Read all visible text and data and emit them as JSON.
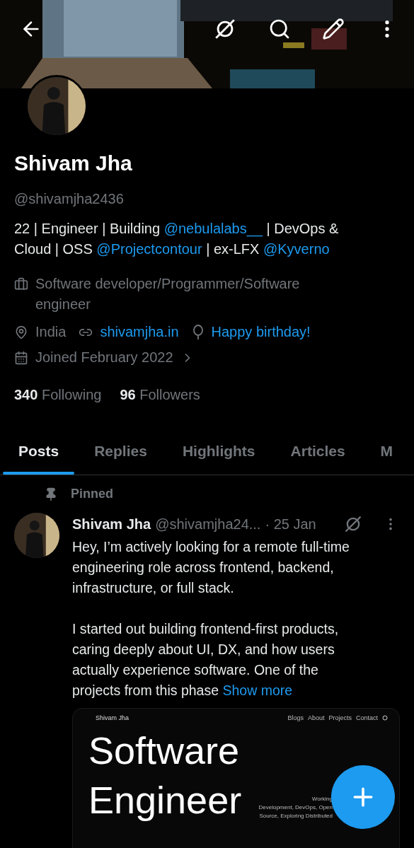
{
  "profile": {
    "name": "Shivam Jha",
    "handle": "@shivamjha2436",
    "bio": [
      {
        "kind": "text",
        "text": "22 | Engineer | Building "
      },
      {
        "kind": "link",
        "text": "@nebulalabs__"
      },
      {
        "kind": "text",
        "text": " | DevOps & Cloud | OSS "
      },
      {
        "kind": "link",
        "text": "@Projectcontour"
      },
      {
        "kind": "text",
        "text": " | ex-LFX "
      },
      {
        "kind": "link",
        "text": "@Kyverno"
      }
    ],
    "details": [
      {
        "kind": "work",
        "text": "Software developer/Programmer/Software engineer"
      },
      {
        "kind": "location",
        "text": "India"
      },
      {
        "kind": "website",
        "text": "shivamjha.in"
      },
      {
        "kind": "birthday",
        "text": "Happy birthday!"
      }
    ],
    "joined": "Joined February 2022",
    "stats": [
      {
        "count": "340",
        "label": "Following"
      },
      {
        "count": "96",
        "label": "Followers"
      }
    ]
  },
  "tabs": [
    {
      "label": "Posts",
      "selected": true
    },
    {
      "label": "Replies",
      "selected": false
    },
    {
      "label": "Highlights",
      "selected": false
    },
    {
      "label": "Articles",
      "selected": false
    },
    {
      "label": "M",
      "selected": false
    }
  ],
  "pinned_post": {
    "pin_label": "Pinned",
    "author": "Shivam Jha",
    "handle": "@shivamjha24...",
    "date": "· 25 Jan",
    "body": "Hey, I’m actively looking for a remote full-time\nengineering role across frontend, backend,\ninfrastructure, or full stack.\n\nI started out building frontend-first products,\ncaring deeply about UI, DX, and how users\nactually experience software. One of the\nprojects from this phase",
    "show_more": "Show more",
    "preview": {
      "site_name": "Shivam Jha",
      "nav": [
        "Blogs",
        "About",
        "Projects",
        "Contact"
      ],
      "headline": [
        "Software",
        "Engineer"
      ],
      "blurb": [
        "Working",
        "Development, DevOps, Open",
        "Source, Exploring Distributed"
      ]
    }
  }
}
